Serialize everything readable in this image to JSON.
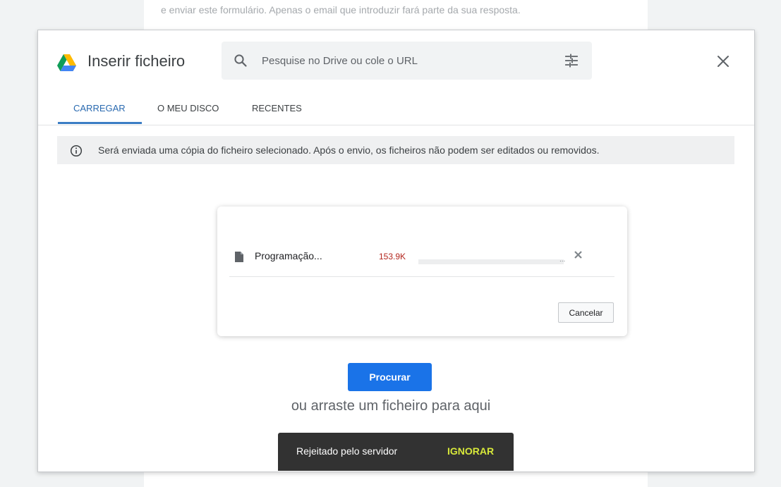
{
  "background": {
    "form_text": "e enviar este formulário. Apenas o email que introduzir fará parte da sua resposta."
  },
  "dialog": {
    "title": "Inserir ficheiro",
    "logo_icon": "google-drive-icon",
    "search": {
      "placeholder": "Pesquise no Drive ou cole o URL",
      "value": "",
      "icon": "search-icon",
      "options_icon": "tune-icon"
    },
    "close_icon": "close-icon",
    "tabs": [
      {
        "label": "CARREGAR",
        "active": true
      },
      {
        "label": "O MEU DISCO",
        "active": false
      },
      {
        "label": "RECENTES",
        "active": false
      }
    ],
    "info_banner": {
      "icon": "info-icon",
      "text": "Será enviada uma cópia do ficheiro selecionado. Após o envio, os ficheiros não podem ser editados ou removidos."
    },
    "upload": {
      "file_icon": "document-icon",
      "file_name": "Programação...",
      "file_size": "153.9K",
      "progress_percent": 0,
      "progress_ellipsis": "...",
      "remove_icon": "close-icon",
      "cancel_label": "Cancelar"
    },
    "browse_label": "Procurar",
    "drop_text": "ou arraste um ficheiro para aqui"
  },
  "snackbar": {
    "message": "Rejeitado pelo servidor",
    "action": "IGNORAR"
  },
  "colors": {
    "accent_blue": "#1a73e8",
    "tab_active": "#2a6ab0",
    "error_red": "#b3261e",
    "snackbar_bg": "#323232",
    "snackbar_action": "#d7e83a"
  }
}
